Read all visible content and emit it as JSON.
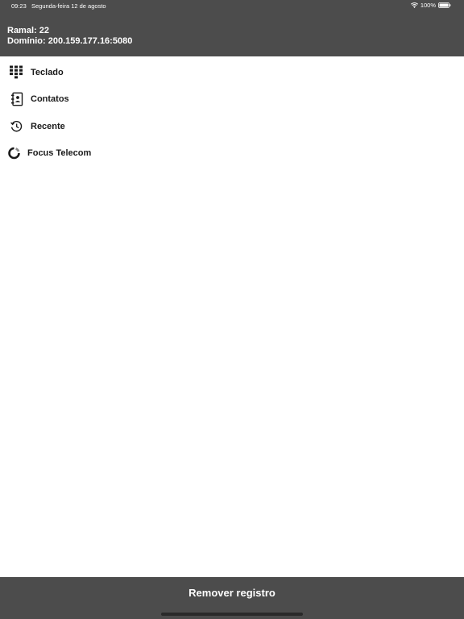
{
  "status_bar": {
    "time": "09:23",
    "date": "Segunda-feira 12 de agosto",
    "battery": "100%",
    "wifi_icon": "wifi-icon",
    "battery_icon": "battery-icon"
  },
  "account": {
    "ramal": "Ramal: 22",
    "dominio": "Domínio: 200.159.177.16:5080"
  },
  "menu": {
    "items": [
      {
        "label": "Teclado",
        "icon": "keypad-icon"
      },
      {
        "label": "Contatos",
        "icon": "contacts-book-icon"
      },
      {
        "label": "Recente",
        "icon": "history-clock-icon"
      },
      {
        "label": "Focus Telecom",
        "icon": "focus-telecom-logo-icon"
      }
    ]
  },
  "footer": {
    "remove_label": "Remover registro"
  },
  "colors": {
    "header_bg": "#4c4c4c",
    "footer_bg": "#4c4c4c",
    "text_dark": "#1a1a1a",
    "text_light": "#ffffff"
  }
}
